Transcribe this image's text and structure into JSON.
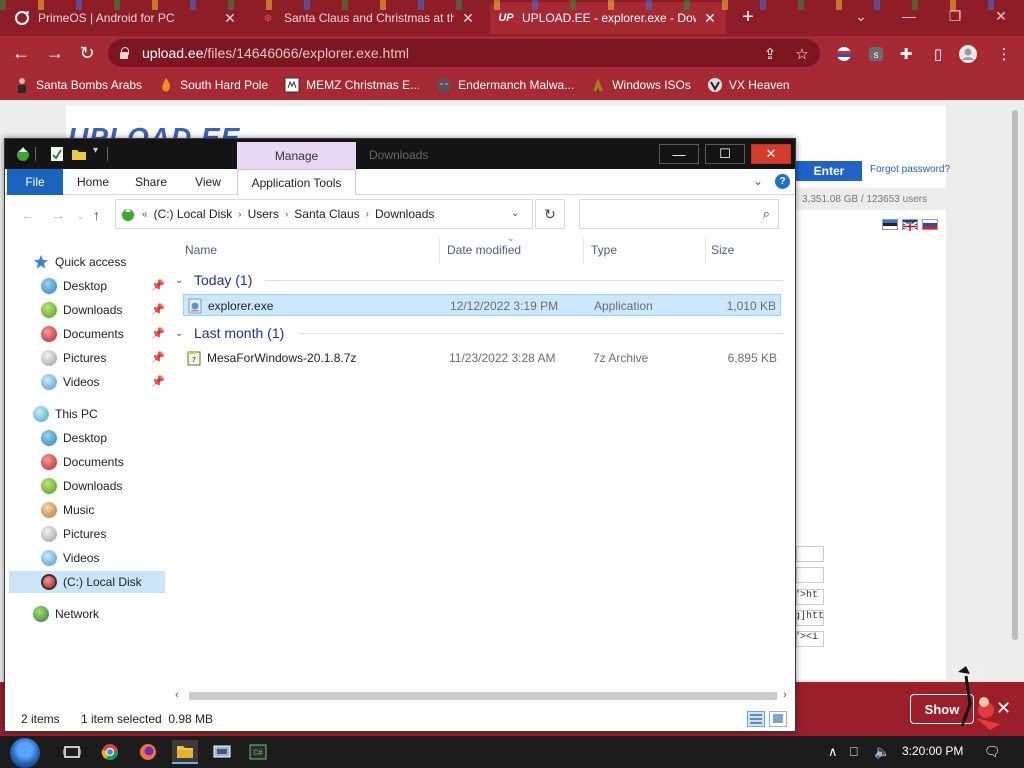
{
  "browser": {
    "tabs": [
      {
        "title": "PrimeOS | Android for PC",
        "icon": "primeos-favicon",
        "active": false
      },
      {
        "title": "Santa Claus and Christmas at the",
        "icon": "snowflake-favicon",
        "active": false
      },
      {
        "title": "UPLOAD.EE - explorer.exe - Down",
        "icon": "upload-ee-favicon",
        "favicon_text": "UP",
        "active": true
      }
    ],
    "url_host": "upload.ee",
    "url_path": "/files/14646066/explorer.exe.html",
    "bookmarks": [
      {
        "label": "Santa Bombs Arabs",
        "icon": "person-icon"
      },
      {
        "label": "South Hard Pole",
        "icon": "flame-icon"
      },
      {
        "label": "MEMZ Christmas E...",
        "icon": "memz-icon"
      },
      {
        "label": "Endermanch Malwa...",
        "icon": "enderman-icon"
      },
      {
        "label": "Windows ISOs",
        "icon": "gift-icon"
      },
      {
        "label": "VX Heaven",
        "icon": "vx-heaven-icon"
      }
    ]
  },
  "webpage": {
    "logo": "UPLOAD.EE",
    "enter_label": "Enter",
    "forgot_label": "Forgot password?",
    "stats": "3,351.08 GB  /  123653 users",
    "snippets": [
      "\">ht",
      "g]htt",
      "\"><i"
    ],
    "banner_show_label": "Show",
    "banner_close": "✕"
  },
  "explorer": {
    "title": "Downloads",
    "context_tab": "Manage",
    "ribbon_tabs": [
      "File",
      "Home",
      "Share",
      "View",
      "Application Tools"
    ],
    "address": [
      "(C:) Local Disk",
      "Users",
      "Santa Claus",
      "Downloads"
    ],
    "address_prefix": "«",
    "columns": [
      "Name",
      "Date modified",
      "Type",
      "Size"
    ],
    "groups": [
      {
        "label": "Today (1)",
        "files": [
          {
            "name": "explorer.exe",
            "date": "12/12/2022 3:19 PM",
            "type": "Application",
            "size": "1,010 KB",
            "icon": "exe-file-icon",
            "selected": true
          }
        ]
      },
      {
        "label": "Last month (1)",
        "files": [
          {
            "name": "MesaForWindows-20.1.8.7z",
            "date": "11/23/2022 3:28 AM",
            "type": "7z Archive",
            "size": "6,895 KB",
            "icon": "7z-archive-icon",
            "selected": false
          }
        ]
      }
    ],
    "nav": {
      "quick_access": "Quick access",
      "quick_items": [
        "Desktop",
        "Downloads",
        "Documents",
        "Pictures",
        "Videos"
      ],
      "this_pc": "This PC",
      "pc_items": [
        "Desktop",
        "Documents",
        "Downloads",
        "Music",
        "Pictures",
        "Videos",
        "(C:) Local Disk"
      ],
      "network": "Network"
    },
    "status": {
      "count": "2 items",
      "selection": "1 item selected  0.98 MB"
    }
  },
  "taskbar": {
    "clock": "3:20:00 PM",
    "apps": [
      "task-view-icon",
      "chrome-icon",
      "firefox-icon",
      "file-explorer-icon",
      "control-panel-icon",
      "terminal-icon"
    ]
  },
  "colors": {
    "chrome_dark": "#8e1d28",
    "chrome": "#a52a33",
    "file_tab": "#1964bd",
    "selection": "#cce8ff",
    "manage_tab": "#e8d8f5"
  }
}
